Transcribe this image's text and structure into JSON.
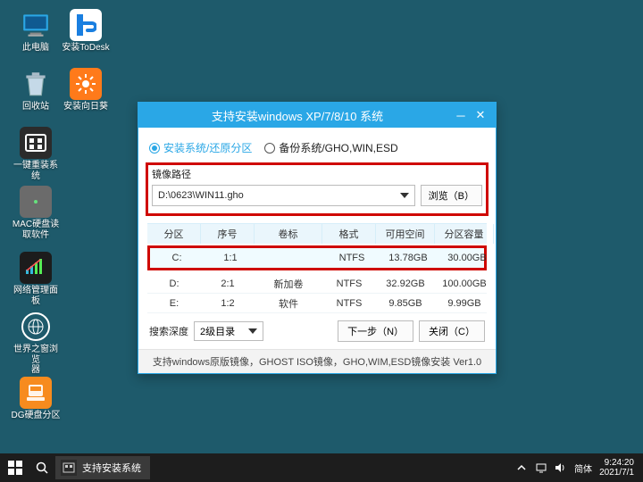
{
  "desktop": {
    "icons": [
      {
        "name": "this-pc",
        "label": "此电脑"
      },
      {
        "name": "install-todesk",
        "label": "安装ToDesk"
      },
      {
        "name": "recycle-bin",
        "label": "回收站"
      },
      {
        "name": "install-sunflower",
        "label": "安装向日葵"
      },
      {
        "name": "onekey-reinstall",
        "label": "一键重装系统"
      },
      {
        "name": "mac-disk-reader",
        "label": "MAC硬盘读\n取软件"
      },
      {
        "name": "network-panel",
        "label": "网络管理面板"
      },
      {
        "name": "the-world-browser",
        "label": "世界之窗浏览\n器"
      },
      {
        "name": "dg-partition",
        "label": "DG硬盘分区"
      }
    ]
  },
  "window": {
    "title": "支持安装windows XP/7/8/10 系统",
    "radio": {
      "install_restore": "安装系统/还原分区",
      "backup": "备份系统/GHO,WIN,ESD"
    },
    "image_path_label": "镜像路径",
    "image_path_value": "D:\\0623\\WIN11.gho",
    "browse_btn": "浏览（B）",
    "table": {
      "headers": [
        "分区",
        "序号",
        "卷标",
        "格式",
        "可用空间",
        "分区容量"
      ],
      "rows": [
        {
          "drive": "C:",
          "idx": "1:1",
          "label": "",
          "fmt": "NTFS",
          "free": "13.78GB",
          "size": "30.00GB",
          "selected": true
        },
        {
          "drive": "D:",
          "idx": "2:1",
          "label": "新加卷",
          "fmt": "NTFS",
          "free": "32.92GB",
          "size": "100.00GB",
          "selected": false
        },
        {
          "drive": "E:",
          "idx": "1:2",
          "label": "软件",
          "fmt": "NTFS",
          "free": "9.85GB",
          "size": "9.99GB",
          "selected": false
        }
      ]
    },
    "search_depth_label": "搜索深度",
    "search_depth_value": "2级目录",
    "next_btn": "下一步（N）",
    "close_btn": "关闭（C）",
    "footer": "支持windows原版镜像，GHOST ISO镜像，GHO,WIM,ESD镜像安装 Ver1.0"
  },
  "taskbar": {
    "active_app": "支持安装系统",
    "ime": "简体",
    "time": "9:24:20",
    "date": "2021/7/1"
  }
}
